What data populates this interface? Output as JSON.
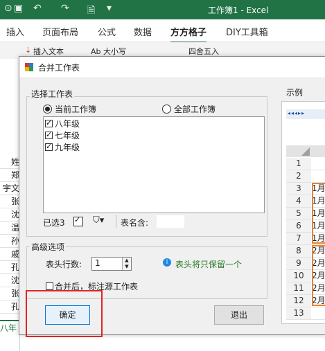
{
  "excel": {
    "title": "工作簿1  -  Excel",
    "tabs": [
      "插入",
      "页面布局",
      "公式",
      "数据",
      "方方格子",
      "DIY工具箱"
    ],
    "active_tab": "方方格子",
    "ribbon_commands": [
      "插入文本",
      "Ab 大小写",
      "四舍五入"
    ],
    "left_cells": [
      "姓",
      "郑",
      "宇文",
      "张",
      "沈",
      "温",
      "孙",
      "戚",
      "孔",
      "沈",
      "张",
      "孔"
    ],
    "sheet_tab": "八年"
  },
  "dialog": {
    "title": "合并工作表",
    "select_group": "选择工作表",
    "radio_current": "当前工作簿",
    "radio_all": "全部工作簿",
    "sheets": [
      {
        "label": "八年级",
        "checked": true
      },
      {
        "label": "七年级",
        "checked": true
      },
      {
        "label": "九年级",
        "checked": true
      }
    ],
    "selected_count": "已选3",
    "sheet_name_label": "表名含:",
    "advanced_group": "高级选项",
    "header_rows_label": "表头行数:",
    "header_rows_value": "1",
    "header_hint": "表头将只保留一个",
    "mark_source_label": "合并后，标注源工作表",
    "ok_button": "确定",
    "exit_button": "退出",
    "preview_label": "示例",
    "preview_rows": [
      {
        "num": "1",
        "text": ""
      },
      {
        "num": "2",
        "text": ""
      },
      {
        "num": "3",
        "text": "1月"
      },
      {
        "num": "4",
        "text": "1月"
      },
      {
        "num": "5",
        "text": "1月"
      },
      {
        "num": "6",
        "text": "1月"
      },
      {
        "num": "7",
        "text": "1月"
      },
      {
        "num": "8",
        "text": "2月"
      },
      {
        "num": "9",
        "text": "2月"
      },
      {
        "num": "10",
        "text": "2月"
      },
      {
        "num": "11",
        "text": "2月"
      },
      {
        "num": "12",
        "text": "2月"
      },
      {
        "num": "13",
        "text": ""
      }
    ]
  },
  "colors": {
    "excel_green": "#217346",
    "highlight_red": "#e02424",
    "accent_orange": "#e8822e",
    "hint_green": "#2a7a2a"
  }
}
